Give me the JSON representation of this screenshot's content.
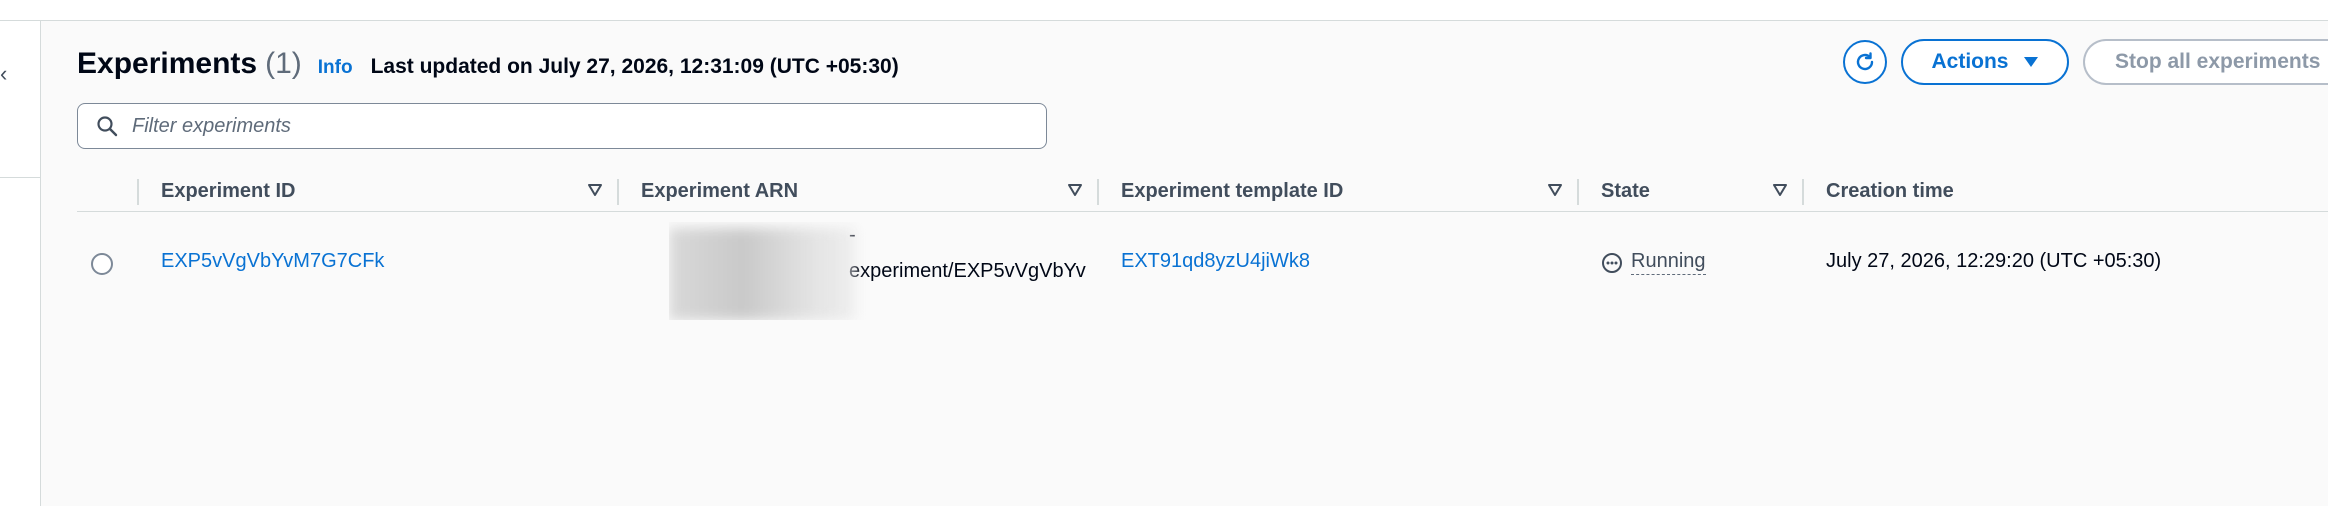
{
  "page": {
    "title": "Experiments",
    "count": "(1)",
    "info_link": "Info",
    "last_updated": "Last updated on July 27, 2026, 12:31:09 (UTC +05:30)"
  },
  "toolbar": {
    "refresh_icon": "refresh-icon",
    "actions_label": "Actions",
    "actions_icon": "caret-down-icon",
    "stop_all_label": "Stop all experiments"
  },
  "filter": {
    "placeholder": "Filter experiments",
    "value": "",
    "icon": "search-icon"
  },
  "table": {
    "columns": [
      {
        "label": "Experiment ID",
        "sortable": true
      },
      {
        "label": "Experiment ARN",
        "sortable": true
      },
      {
        "label": "Experiment template ID",
        "sortable": true
      },
      {
        "label": "State",
        "sortable": true
      },
      {
        "label": "Creation time",
        "sortable": false
      }
    ],
    "rows": [
      {
        "selected": false,
        "experiment_id": "EXP5vVgVbYvM7G7CFk",
        "arn_line1": "-",
        "arn_line2": "experiment/EXP5vVgVbYv",
        "template_id": "EXT91qd8yzU4jiWk8",
        "state": "Running",
        "state_icon": "status-in-progress-icon",
        "creation_time": "July 27, 2026, 12:29:20 (UTC +05:30)"
      }
    ]
  },
  "colors": {
    "link": "#0972d3",
    "text": "#000716",
    "muted": "#5f6b7a",
    "border": "#d5dbdb",
    "panel_bg": "#fafafa"
  }
}
